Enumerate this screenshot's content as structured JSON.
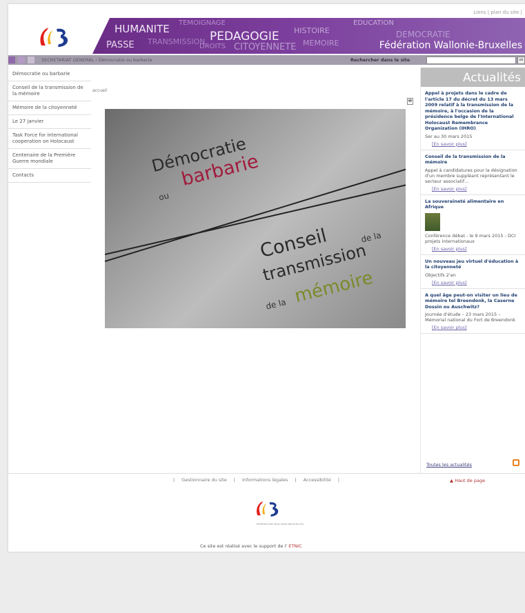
{
  "header": {
    "top_links": "Liens | plan du site |",
    "banner_words": [
      "HUMANITE",
      "PASSE",
      "PEDAGOGIE",
      "TEMOIGNAGE",
      "TRANSMISSION",
      "DROITS",
      "CITOYENNETE",
      "HISTOIRE",
      "EDUCATION",
      "MEMOIRE",
      "DEMOCRATIE"
    ],
    "site_name": "Fédération Wallonie-Bruxelles"
  },
  "breadcrumb_bar": {
    "crumb": "SECRETARIAT GENERAL › Démocratie ou barbarie",
    "search_label": "Rechercher dans le site",
    "search_value": "",
    "search_go": "ok"
  },
  "sidebar": {
    "items": [
      {
        "label": "Démocratie ou barbarie"
      },
      {
        "label": "Conseil de la transmission de la mémoire"
      },
      {
        "label": "Mémoire de la citoyenneté"
      },
      {
        "label": "Le 27 janvier"
      },
      {
        "label": "Task Force for international cooperation on Holocaust"
      },
      {
        "label": "Centenaire de la Première Guerre mondiale"
      },
      {
        "label": "Contacts"
      }
    ]
  },
  "main": {
    "small_crumb": "accueil",
    "print_icon": "🖶",
    "hero": {
      "line1": "Démocratie",
      "line2": "ou",
      "line3": "barbarie",
      "line4": "Conseil",
      "line5": "de la",
      "line6": "transmission",
      "line7": "de la",
      "line8": "mémoire"
    }
  },
  "news": {
    "header": "Actualités",
    "items": [
      {
        "title": "Appel à projets dans le cadre de l'article 17 du décret du 13 mars 2009 relatif à la transmission de la mémoire, à l'occasion de la présidence belge de l'International Holocaust Remembrance Organization (IHRO)",
        "text": "Ser au 30 mars 2015",
        "more": "[En savoir plus]"
      },
      {
        "title": "Conseil de la transmission de la mémoire",
        "text": "Appel à candidatures pour la désignation d'un membre suppléant représentant le secteur associatif…",
        "more": "[En savoir plus]"
      },
      {
        "title": "La souveraineté alimentaire en Afrique",
        "text": "Conférence débat - le 9 mars 2015 - DCI projets internationaux",
        "more": "[En savoir plus]",
        "thumb": true
      },
      {
        "title": "Un nouveau jeu virtuel d'éducation à la citoyenneté",
        "text": "Objectifs 2'an",
        "more": "[En savoir plus]"
      },
      {
        "title": "A quel âge peut-on visiter un lieu de mémoire tel Breendonk, la Caserne Dossin ou Auschwitz?",
        "text": "Journée d'étude – 23 mars 2015 – Mémorial national du Fort de Breendonk",
        "more": "[En savoir plus]"
      }
    ],
    "all_link": "Toutes les actualités"
  },
  "footer": {
    "links": [
      "Gestionnaire du site",
      "Informations légales",
      "Accessibilité"
    ],
    "top_link": "▲ Haut de page",
    "logo_text": "FÉDÉRATION WALLONIE-BRUXELLES",
    "note": "Ce site est réalisé avec le support de l'",
    "note_org": "ETNIC"
  }
}
